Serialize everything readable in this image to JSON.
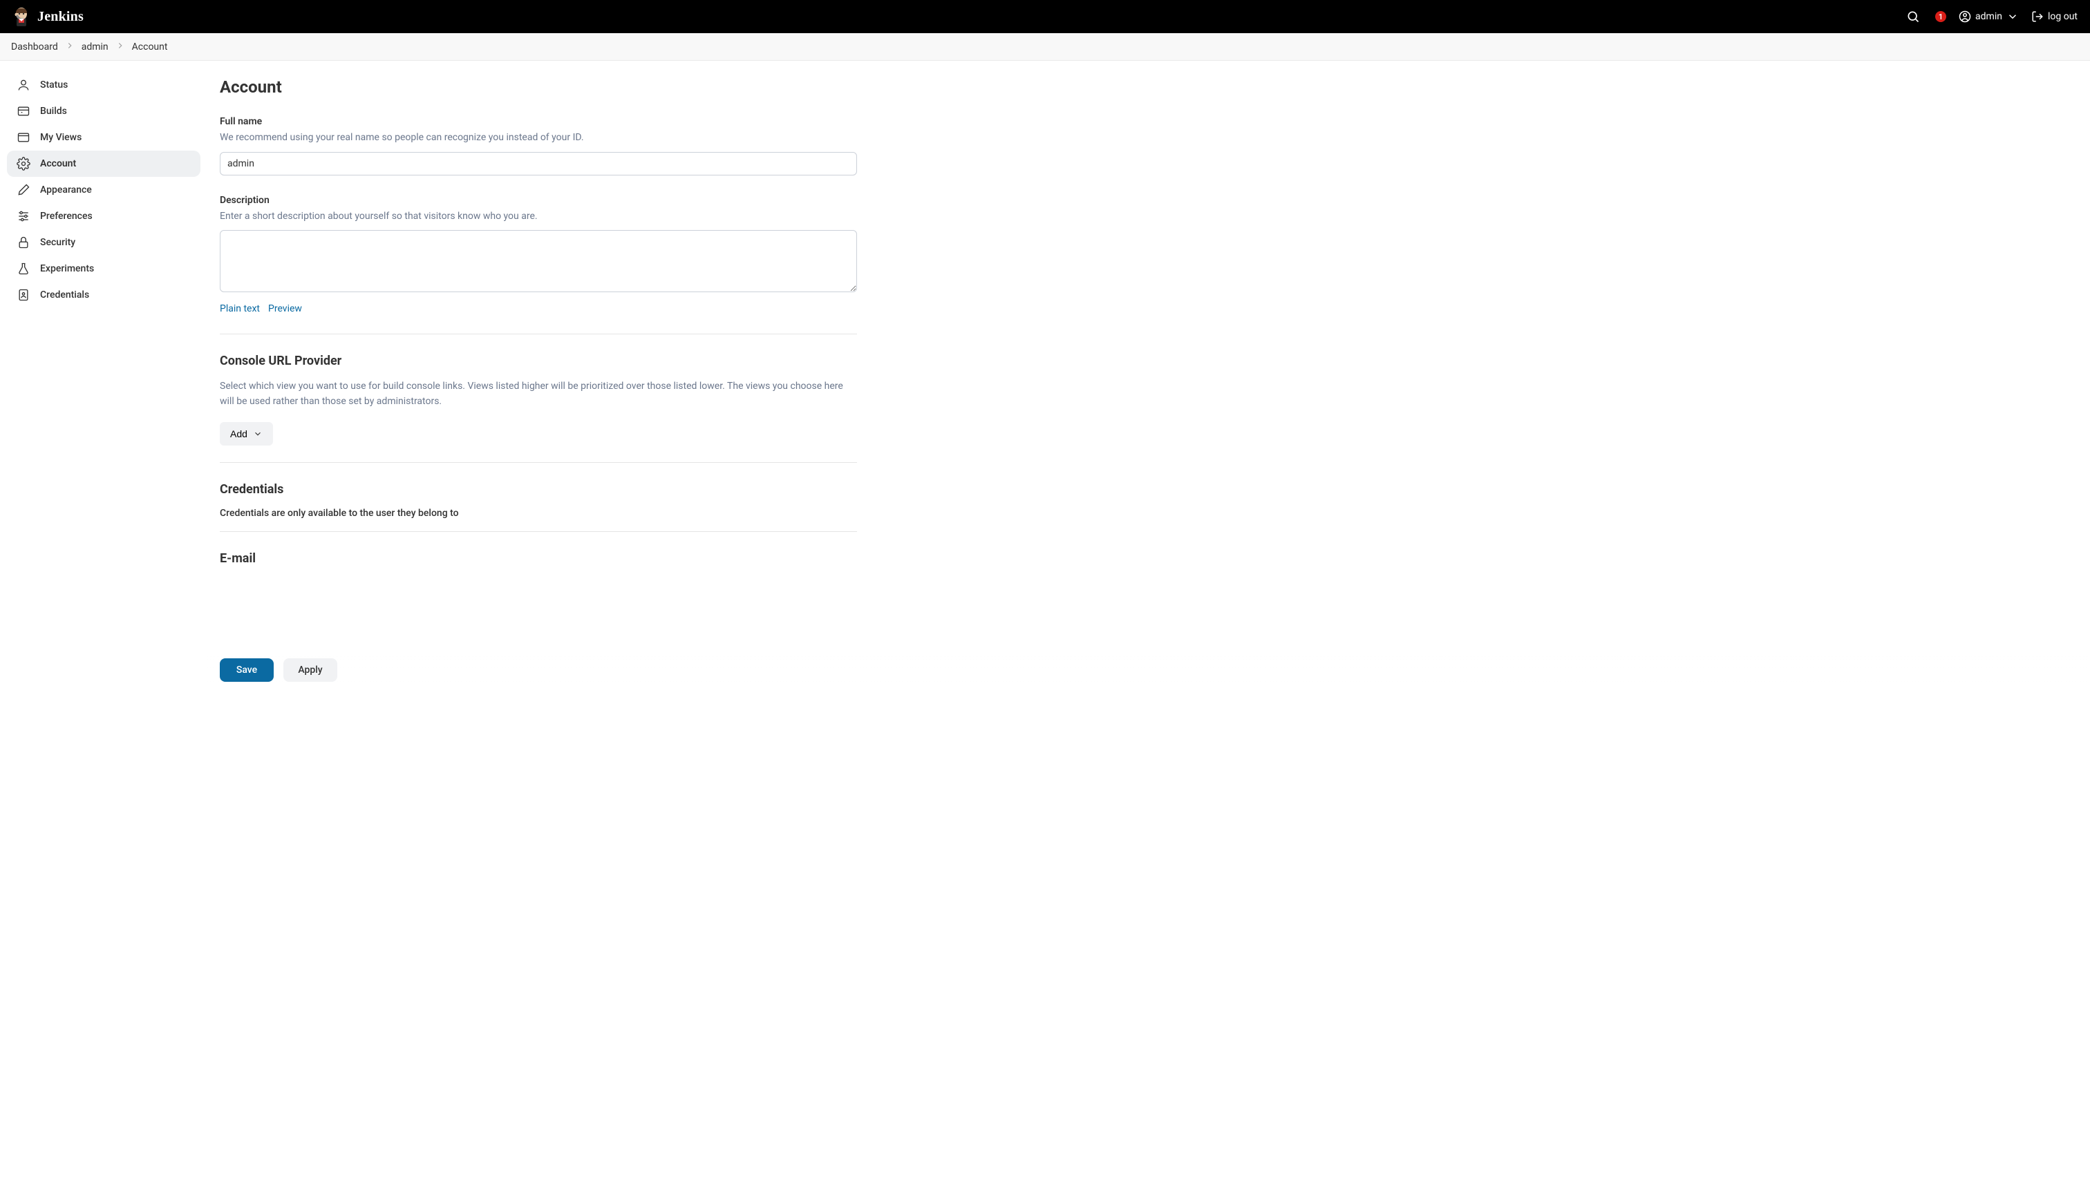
{
  "header": {
    "brand": "Jenkins",
    "notification_count": "1",
    "username": "admin",
    "logout_label": "log out"
  },
  "breadcrumbs": [
    {
      "label": "Dashboard"
    },
    {
      "label": "admin"
    },
    {
      "label": "Account"
    }
  ],
  "sidebar": {
    "items": [
      {
        "label": "Status",
        "icon": "user-icon"
      },
      {
        "label": "Builds",
        "icon": "builds-icon"
      },
      {
        "label": "My Views",
        "icon": "views-icon"
      },
      {
        "label": "Account",
        "icon": "gear-icon"
      },
      {
        "label": "Appearance",
        "icon": "brush-icon"
      },
      {
        "label": "Preferences",
        "icon": "sliders-icon"
      },
      {
        "label": "Security",
        "icon": "lock-icon"
      },
      {
        "label": "Experiments",
        "icon": "flask-icon"
      },
      {
        "label": "Credentials",
        "icon": "id-icon"
      }
    ],
    "active_index": 3
  },
  "page": {
    "title": "Account",
    "fullname": {
      "label": "Full name",
      "help": "We recommend using your real name so people can recognize you instead of your ID.",
      "value": "admin"
    },
    "description": {
      "label": "Description",
      "help": "Enter a short description about yourself so that visitors know who you are.",
      "value": "",
      "plain_text_link": "Plain text",
      "preview_link": "Preview"
    },
    "console_provider": {
      "title": "Console URL Provider",
      "help": "Select which view you want to use for build console links. Views listed higher will be prioritized over those listed lower. The views you choose here will be used rather than those set by administrators.",
      "add_label": "Add"
    },
    "credentials": {
      "title": "Credentials",
      "note": "Credentials are only available to the user they belong to"
    },
    "email": {
      "title": "E-mail"
    }
  },
  "buttons": {
    "save": "Save",
    "apply": "Apply"
  }
}
